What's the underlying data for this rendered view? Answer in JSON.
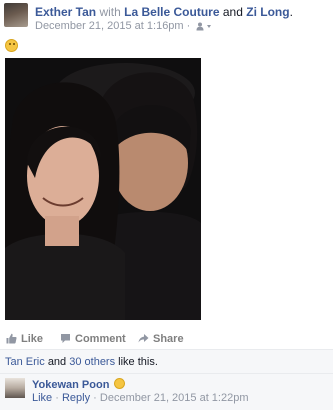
{
  "post": {
    "author": "Exther Tan",
    "with_word": "with",
    "tagged_1": "La Belle Couture",
    "and_word": "and",
    "tagged_2": "Zi Long",
    "header_period": ".",
    "timestamp": "December 21, 2015 at 1:16pm",
    "timestamp_separator": "·",
    "audience_icon": "friends-icon",
    "status_emoji": "smiley-emoji"
  },
  "actions": {
    "like_label": "Like",
    "comment_label": "Comment",
    "share_label": "Share"
  },
  "likes": {
    "first_name": "Tan Eric",
    "and_word": "and",
    "others_link": "30 others",
    "suffix": "like this."
  },
  "comment": {
    "author": "Yokewan Poon",
    "emoji": "smiley-emoji",
    "like_label": "Like",
    "separator": "·",
    "reply_label": "Reply",
    "timestamp": "December 21, 2015 at 1:22pm"
  },
  "colors": {
    "link": "#3b5998",
    "muted": "#9197a3",
    "bar_bg": "#f6f7f9"
  }
}
